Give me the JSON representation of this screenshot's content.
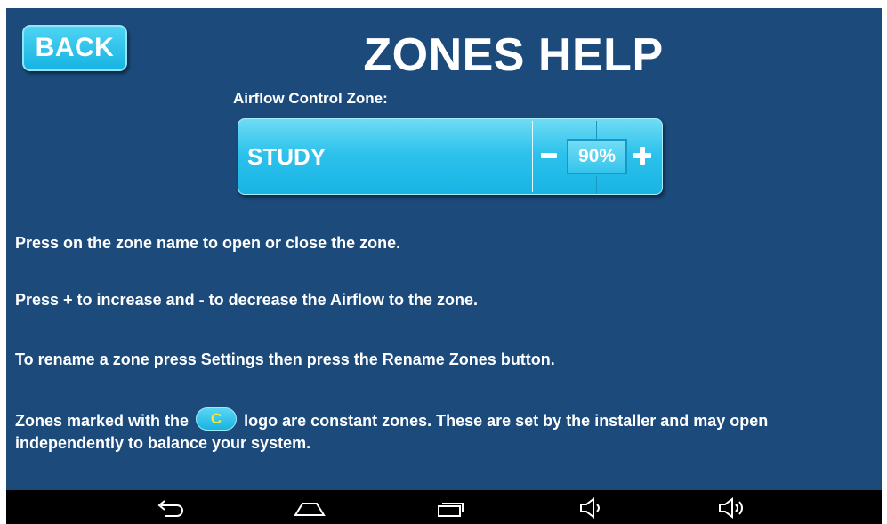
{
  "header": {
    "back_label": "BACK",
    "title": "ZONES HELP"
  },
  "zone_example": {
    "caption": "Airflow Control Zone:",
    "zone_name": "STUDY",
    "airflow_value": "90%"
  },
  "help": {
    "line1": "Press on the zone name to open or close the zone.",
    "line2": "Press + to increase and - to decrease the Airflow to the zone.",
    "line3": "To rename a zone press Settings then press the Rename Zones button.",
    "line4_before": "Zones marked with the",
    "line4_logo": "C",
    "line4_after": "logo are constant zones. These are set by the installer and may open independently to balance your system."
  },
  "nav_bar": {
    "icons": [
      "back-arrow-icon",
      "home-icon",
      "recent-apps-icon",
      "volume-down-icon",
      "volume-up-icon"
    ]
  },
  "colors": {
    "background": "#1b4a7b",
    "button_accent": "#1ab5e4",
    "logo_letter": "#f5e62b"
  }
}
